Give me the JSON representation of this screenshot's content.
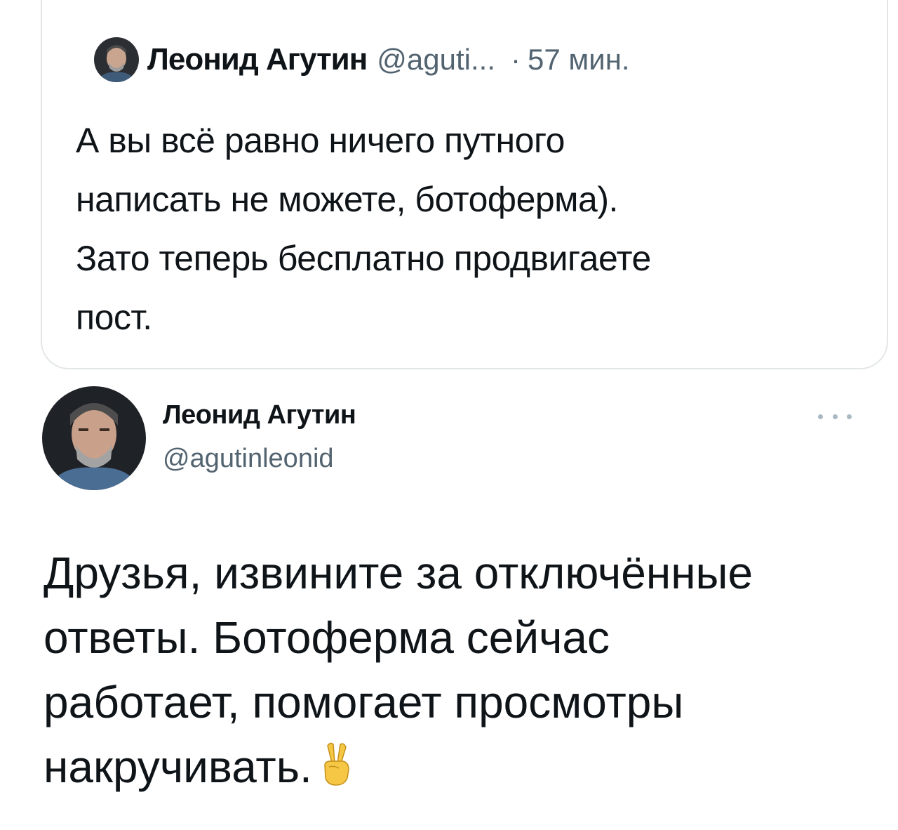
{
  "quoted_tweet": {
    "author_name": "Леонид Агутин",
    "author_handle": "@aguti...",
    "separator": "·",
    "time": "57 мин.",
    "text": "А вы всё равно ничего путного\nнаписать не можете, ботоферма).\nЗато теперь бесплатно продвигаете\nпост."
  },
  "tweet": {
    "author_name": "Леонид Агутин",
    "author_handle": "@agutinleonid",
    "text": "Друзья, извините за отключённые\nответы. Ботоферма сейчас\nработает, помогает просмотры\nнакручивать.",
    "emoji": "victory-hand"
  },
  "icons": {
    "more": "more-options-icon",
    "avatar": "avatar"
  },
  "colors": {
    "text": "#0f1419",
    "secondary": "#536471",
    "border": "#e3e6e8"
  }
}
